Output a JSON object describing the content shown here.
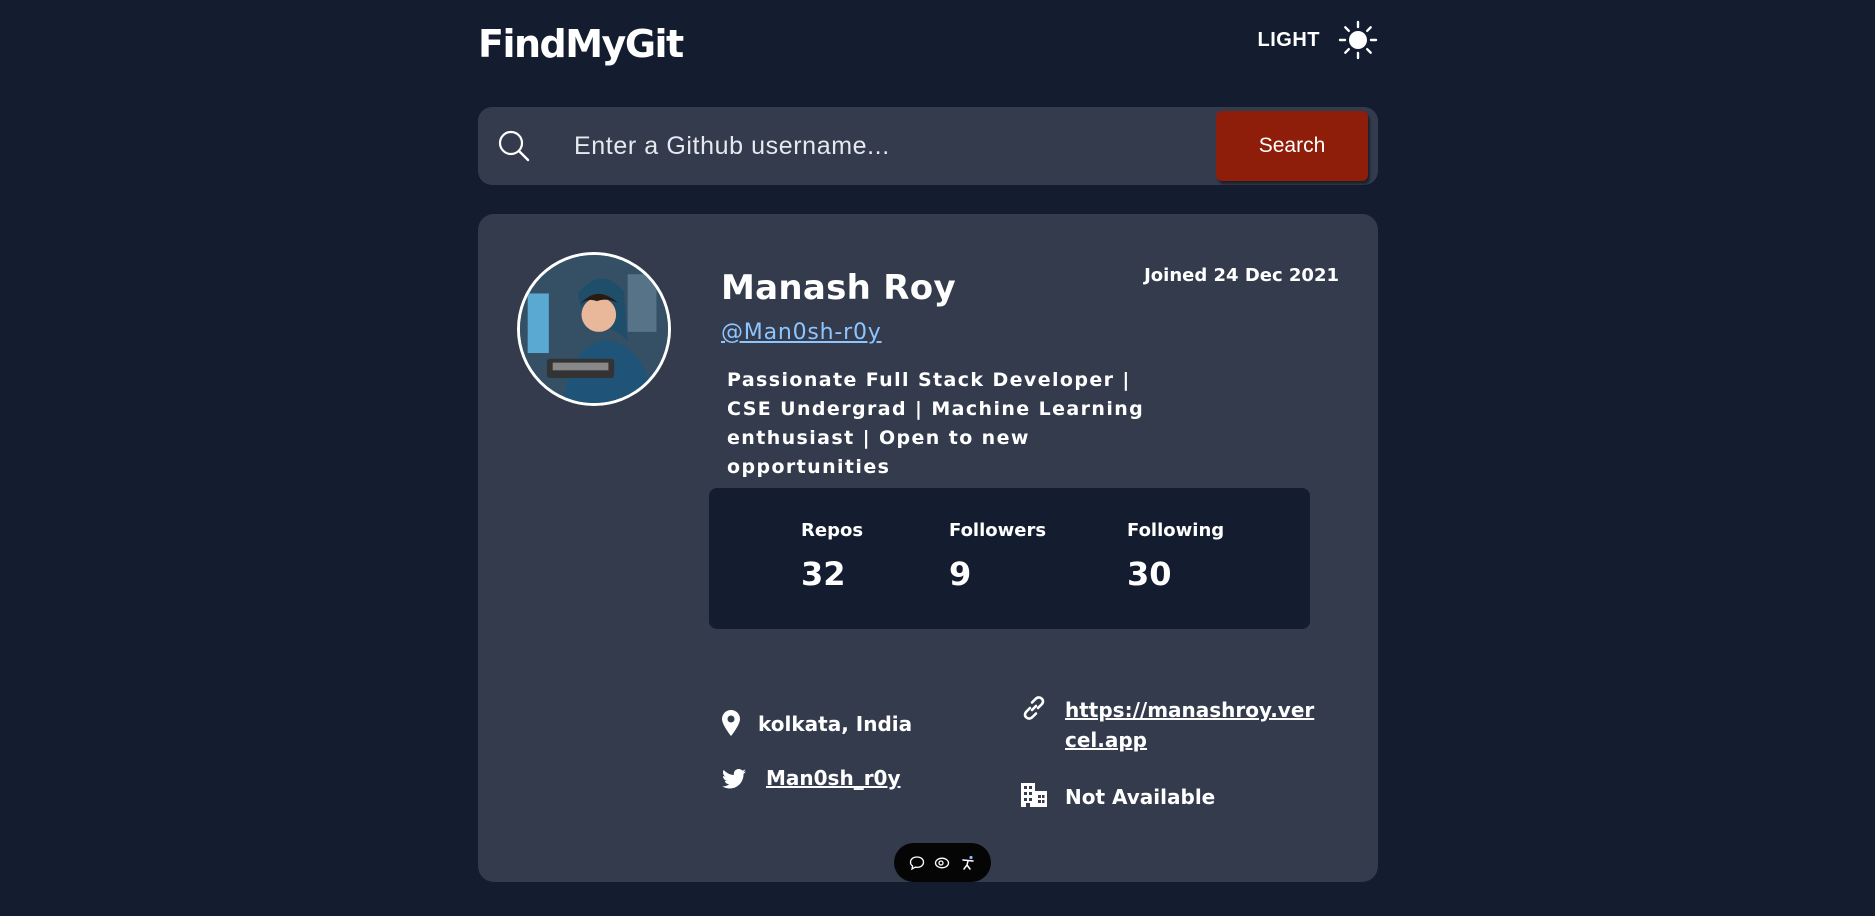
{
  "header": {
    "brand": "FindMyGit",
    "theme_label": "LIGHT",
    "theme_icon": "sun-icon"
  },
  "search": {
    "placeholder": "Enter a Github username...",
    "value": "",
    "button_label": "Search",
    "icon": "search-icon"
  },
  "profile": {
    "name": "Manash Roy",
    "handle": "@Man0sh-r0y",
    "joined": "Joined 24 Dec 2021",
    "bio": "Passionate Full Stack Developer | CSE Undergrad | Machine Learning enthusiast | Open to new opportunities",
    "stats": [
      {
        "label": "Repos",
        "value": "32"
      },
      {
        "label": "Followers",
        "value": "9"
      },
      {
        "label": "Following",
        "value": "30"
      }
    ],
    "location": "kolkata, India",
    "blog_line1": "https://manashroy.ver",
    "blog_line2": "cel.app",
    "twitter": "Man0sh_r0y",
    "company": "Not Available"
  },
  "colors": {
    "background": "#141c2f",
    "card": "#333b4d",
    "accent_button": "#8e1e09",
    "link": "#8ec5ff"
  },
  "floating_bar": {
    "icons": [
      "chat-icon",
      "eye-icon",
      "accessibility-icon"
    ]
  }
}
